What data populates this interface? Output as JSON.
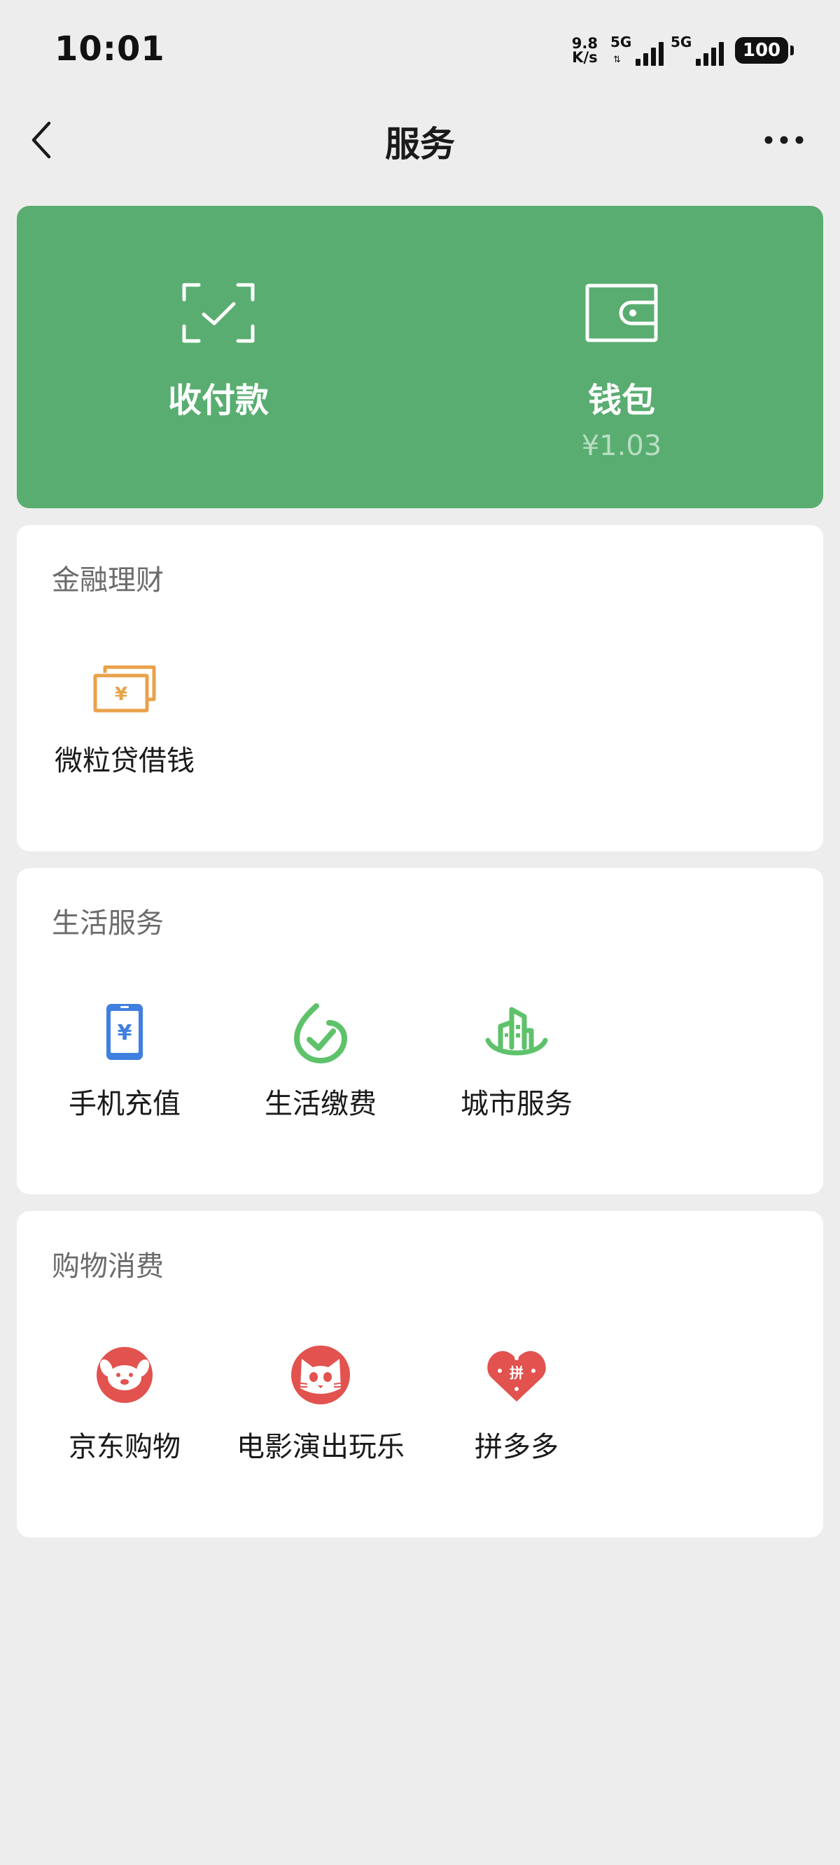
{
  "status_bar": {
    "time": "10:01",
    "net_speed_value": "9.8",
    "net_speed_unit": "K/s",
    "sim1_label": "5G",
    "sim2_label": "5G",
    "battery": "100"
  },
  "nav": {
    "title": "服务",
    "back_icon": "chevron-left-icon",
    "more_icon": "more-dots-icon"
  },
  "pay_card": {
    "background_color": "#59ad70",
    "items": [
      {
        "label": "收付款",
        "icon": "scan-check-icon"
      },
      {
        "label": "钱包",
        "sub": "¥1.03",
        "icon": "wallet-icon"
      }
    ]
  },
  "sections": [
    {
      "title": "金融理财",
      "items": [
        {
          "label": "微粒贷借钱",
          "icon": "yuan-bills-icon",
          "color": "#e8a24b"
        }
      ]
    },
    {
      "title": "生活服务",
      "items": [
        {
          "label": "手机充值",
          "icon": "phone-yuan-icon",
          "color": "#3f7fe0"
        },
        {
          "label": "生活缴费",
          "icon": "check-circle-icon",
          "color": "#5ec26a"
        },
        {
          "label": "城市服务",
          "icon": "city-buildings-icon",
          "color": "#5ec26a"
        }
      ]
    },
    {
      "title": "购物消费",
      "items": [
        {
          "label": "京东购物",
          "icon": "jd-dog-icon",
          "color": "#e2524e"
        },
        {
          "label": "电影演出玩乐",
          "icon": "cat-face-icon",
          "color": "#e2524e"
        },
        {
          "label": "拼多多",
          "icon": "pinduoduo-heart-icon",
          "color": "#e2524e"
        }
      ]
    }
  ]
}
